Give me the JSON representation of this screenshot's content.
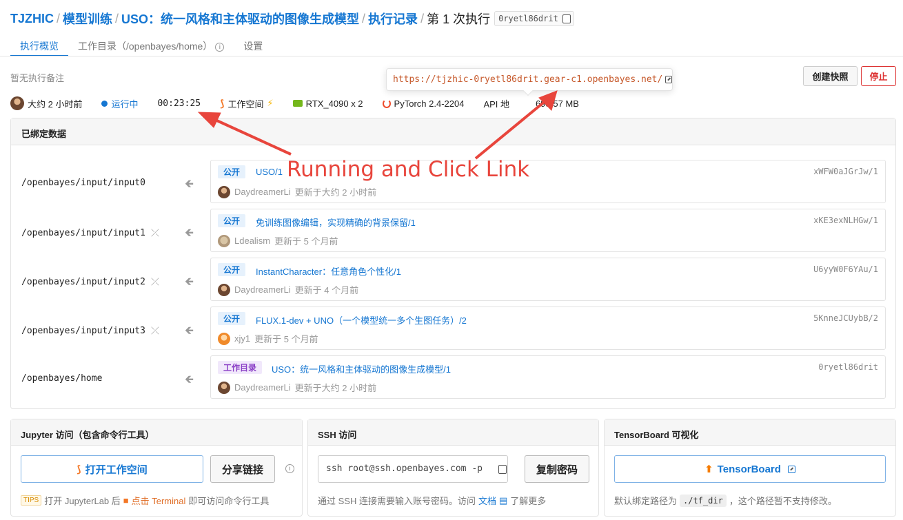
{
  "breadcrumb": {
    "org": "TJZHIC",
    "section": "模型训练",
    "project": "USO：统一风格和主体驱动的图像生成模型",
    "records": "执行记录",
    "current": "第 1 次执行",
    "run_id": "0ryetl86drit",
    "sep": "/"
  },
  "tabs": [
    {
      "label": "执行概览"
    },
    {
      "label": "工作目录（/openbayes/home）"
    },
    {
      "label": "设置"
    }
  ],
  "note": "暂无执行备注",
  "tooltip_url": "https://tjzhic-0ryetl86drit.gear-c1.openbayes.net/",
  "buttons": {
    "snapshot": "创建快照",
    "stop": "停止"
  },
  "status": {
    "created": "大约 2 小时前",
    "state": "运行中",
    "elapsed": "00:23:25",
    "workspace": "工作空间",
    "gpu": "RTX_4090 x 2",
    "framework": "PyTorch 2.4-2204",
    "api": "API 地",
    "size": "695.57 MB"
  },
  "bound_data": {
    "title": "已绑定数据",
    "rows": [
      {
        "path": "/openbayes/input/input0",
        "unlinked": false,
        "tag": "公开",
        "title": "USO/1",
        "hash": "xWFW0aJGrJw/1",
        "user": "DaydreamerLi",
        "updated": "更新于大约 2 小时前"
      },
      {
        "path": "/openbayes/input/input1",
        "unlinked": true,
        "tag": "公开",
        "title": "免训练图像编辑，实现精确的背景保留/1",
        "hash": "xKE3exNLHGw/1",
        "user": "Ldealism",
        "updated": "更新于 5 个月前"
      },
      {
        "path": "/openbayes/input/input2",
        "unlinked": true,
        "tag": "公开",
        "title": "InstantCharacter：任意角色个性化/1",
        "hash": "U6yyW0F6YAu/1",
        "user": "DaydreamerLi",
        "updated": "更新于 4 个月前"
      },
      {
        "path": "/openbayes/input/input3",
        "unlinked": true,
        "tag": "公开",
        "title": "FLUX.1-dev + UNO（一个模型统一多个生图任务）/2",
        "hash": "5KnneJCUybB/2",
        "user": "xjy1",
        "updated": "更新于 5 个月前"
      },
      {
        "path": "/openbayes/home",
        "unlinked": false,
        "tag": "工作目录",
        "title": "USO：统一风格和主体驱动的图像生成模型/1",
        "hash": "0ryetl86drit",
        "user": "DaydreamerLi",
        "updated": "更新于大约 2 小时前"
      }
    ]
  },
  "jupyter": {
    "title": "Jupyter 访问（包含命令行工具）",
    "open_btn": "打开工作空间",
    "share_btn": "分享链接",
    "tips_badge": "TIPS",
    "tips_pre": "打开 JupyterLab 后",
    "tips_link": "点击 Terminal",
    "tips_post": "即可访问命令行工具"
  },
  "ssh": {
    "title": "SSH 访问",
    "command": "ssh root@ssh.openbayes.com -p",
    "copy_btn": "复制密码",
    "foot_pre": "通过 SSH 连接需要输入账号密码。访问",
    "foot_link": "文档",
    "foot_post": "了解更多"
  },
  "tensorboard": {
    "title": "TensorBoard 可视化",
    "btn": "TensorBoard",
    "foot_pre": "默认绑定路径为",
    "path": "./tf_dir",
    "foot_post": "，这个路径暂不支持修改。"
  },
  "annotation": {
    "text": "Running and Click Link",
    "color": "#e8453c"
  }
}
